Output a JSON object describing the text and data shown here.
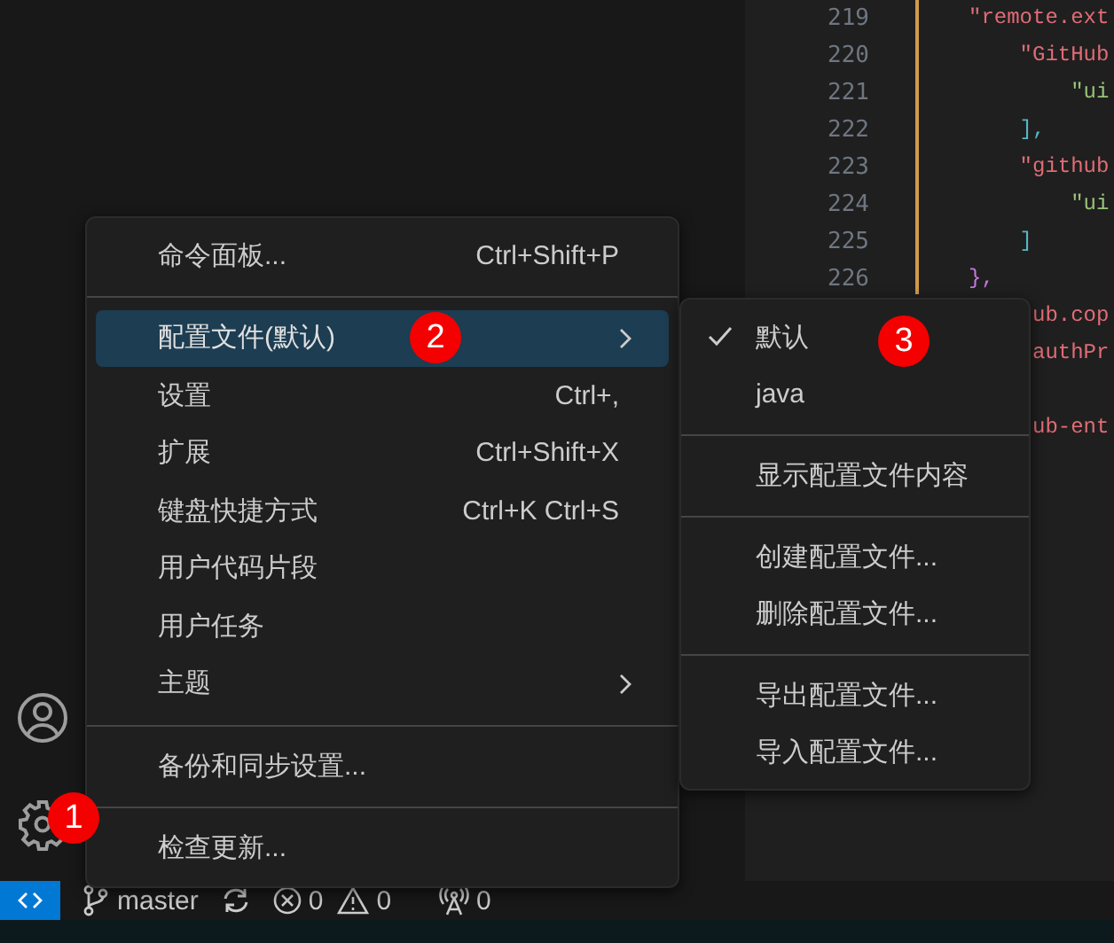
{
  "editor": {
    "lines": [
      {
        "number": "219",
        "kind": "key",
        "text": "\"remote.ext"
      },
      {
        "number": "220",
        "kind": "key",
        "text": "    \"GitHub"
      },
      {
        "number": "221",
        "kind": "value",
        "text": "        \"ui"
      },
      {
        "number": "222",
        "kind": "bracket",
        "text": "    ],"
      },
      {
        "number": "223",
        "kind": "key",
        "text": "    \"github"
      },
      {
        "number": "224",
        "kind": "value",
        "text": "        \"ui"
      },
      {
        "number": "225",
        "kind": "bracket",
        "text": "    ]"
      },
      {
        "number": "226",
        "kind": "brace",
        "text": "},"
      },
      {
        "kind": "key",
        "covered": true,
        "text": "ub.cop"
      },
      {
        "kind": "key",
        "covered": true,
        "text": "authPr"
      },
      {
        "kind": "blank"
      },
      {
        "kind": "key",
        "covered": true,
        "text": "ub-ent"
      }
    ]
  },
  "menu": {
    "items": [
      {
        "kind": "item",
        "label": "命令面板...",
        "shortcut": "Ctrl+Shift+P",
        "selected": false
      },
      {
        "kind": "separator"
      },
      {
        "kind": "submenu",
        "label": "配置文件(默认)",
        "selected": true
      },
      {
        "kind": "item",
        "label": "设置",
        "shortcut": "Ctrl+,",
        "selected": false
      },
      {
        "kind": "item",
        "label": "扩展",
        "shortcut": "Ctrl+Shift+X",
        "selected": false
      },
      {
        "kind": "item",
        "label": "键盘快捷方式",
        "shortcut": "Ctrl+K Ctrl+S",
        "selected": false
      },
      {
        "kind": "item",
        "label": "用户代码片段",
        "selected": false
      },
      {
        "kind": "item",
        "label": "用户任务",
        "selected": false
      },
      {
        "kind": "submenu",
        "label": "主题",
        "selected": false
      },
      {
        "kind": "separator"
      },
      {
        "kind": "item",
        "label": "备份和同步设置...",
        "selected": false
      },
      {
        "kind": "separator"
      },
      {
        "kind": "item",
        "label": "检查更新...",
        "selected": false
      }
    ]
  },
  "submenu": {
    "items": [
      {
        "kind": "item",
        "label": "默认",
        "checked": true
      },
      {
        "kind": "item",
        "label": "java",
        "checked": false
      },
      {
        "kind": "separator"
      },
      {
        "kind": "item",
        "label": "显示配置文件内容",
        "checked": false
      },
      {
        "kind": "separator"
      },
      {
        "kind": "item",
        "label": "创建配置文件...",
        "checked": false
      },
      {
        "kind": "item",
        "label": "删除配置文件...",
        "checked": false
      },
      {
        "kind": "separator"
      },
      {
        "kind": "item",
        "label": "导出配置文件...",
        "checked": false
      },
      {
        "kind": "item",
        "label": "导入配置文件...",
        "checked": false
      }
    ]
  },
  "callouts": [
    {
      "label": "1"
    },
    {
      "label": "2"
    },
    {
      "label": "3"
    }
  ],
  "status_bar": {
    "branch": "master",
    "errors": "0",
    "warnings": "0",
    "ports": "0"
  }
}
